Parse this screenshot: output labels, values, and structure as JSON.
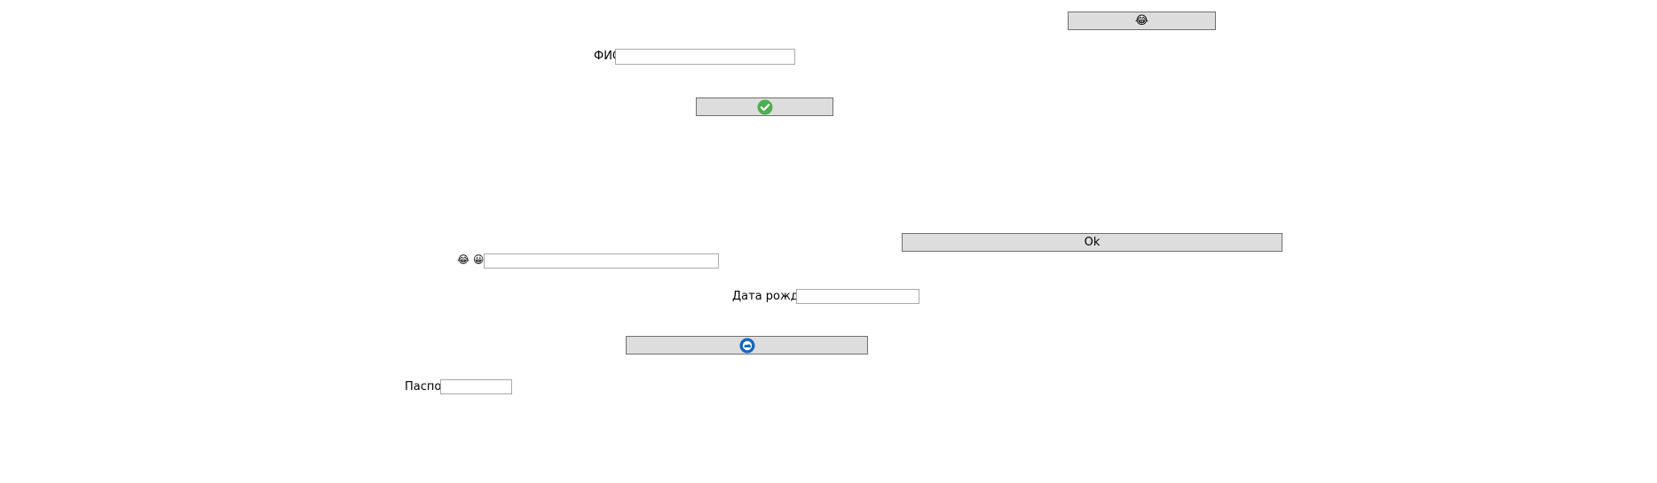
{
  "buttons": {
    "top_emoji": {
      "glyph": "😂",
      "icon": "laughing-emoji-icon"
    },
    "check": {
      "icon": "check-circle-icon",
      "color": "#4caf50"
    },
    "ok": {
      "label": "Ok"
    },
    "blue": {
      "icon": "blue-circle-icon",
      "color": "#1565c0"
    }
  },
  "fields": {
    "fio": {
      "label": "ФИО",
      "value": ""
    },
    "emoji": {
      "label_glyphs": "😂 😀",
      "value": ""
    },
    "birth_date": {
      "label": "Дата рождения",
      "value": ""
    },
    "passport": {
      "label": "Паспорт",
      "value": ""
    }
  }
}
